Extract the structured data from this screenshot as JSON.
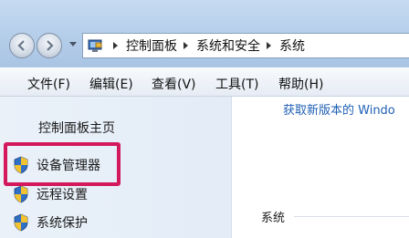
{
  "address_bar": {
    "breadcrumbs": [
      "控制面板",
      "系统和安全",
      "系统"
    ]
  },
  "menu": {
    "items": [
      "文件(F)",
      "编辑(E)",
      "查看(V)",
      "工具(T)",
      "帮助(H)"
    ]
  },
  "left_pane": {
    "home_link": "控制面板主页",
    "tasks": [
      {
        "label": "设备管理器",
        "icon": "shield-icon",
        "highlighted": true
      },
      {
        "label": "远程设置",
        "icon": "shield-icon"
      },
      {
        "label": "系统保护",
        "icon": "shield-icon"
      }
    ]
  },
  "right_pane": {
    "link": "获取新版本的 Windo",
    "section_title": "系统"
  },
  "colors": {
    "highlight_border": "#d3185b",
    "link": "#1f5fb4"
  }
}
